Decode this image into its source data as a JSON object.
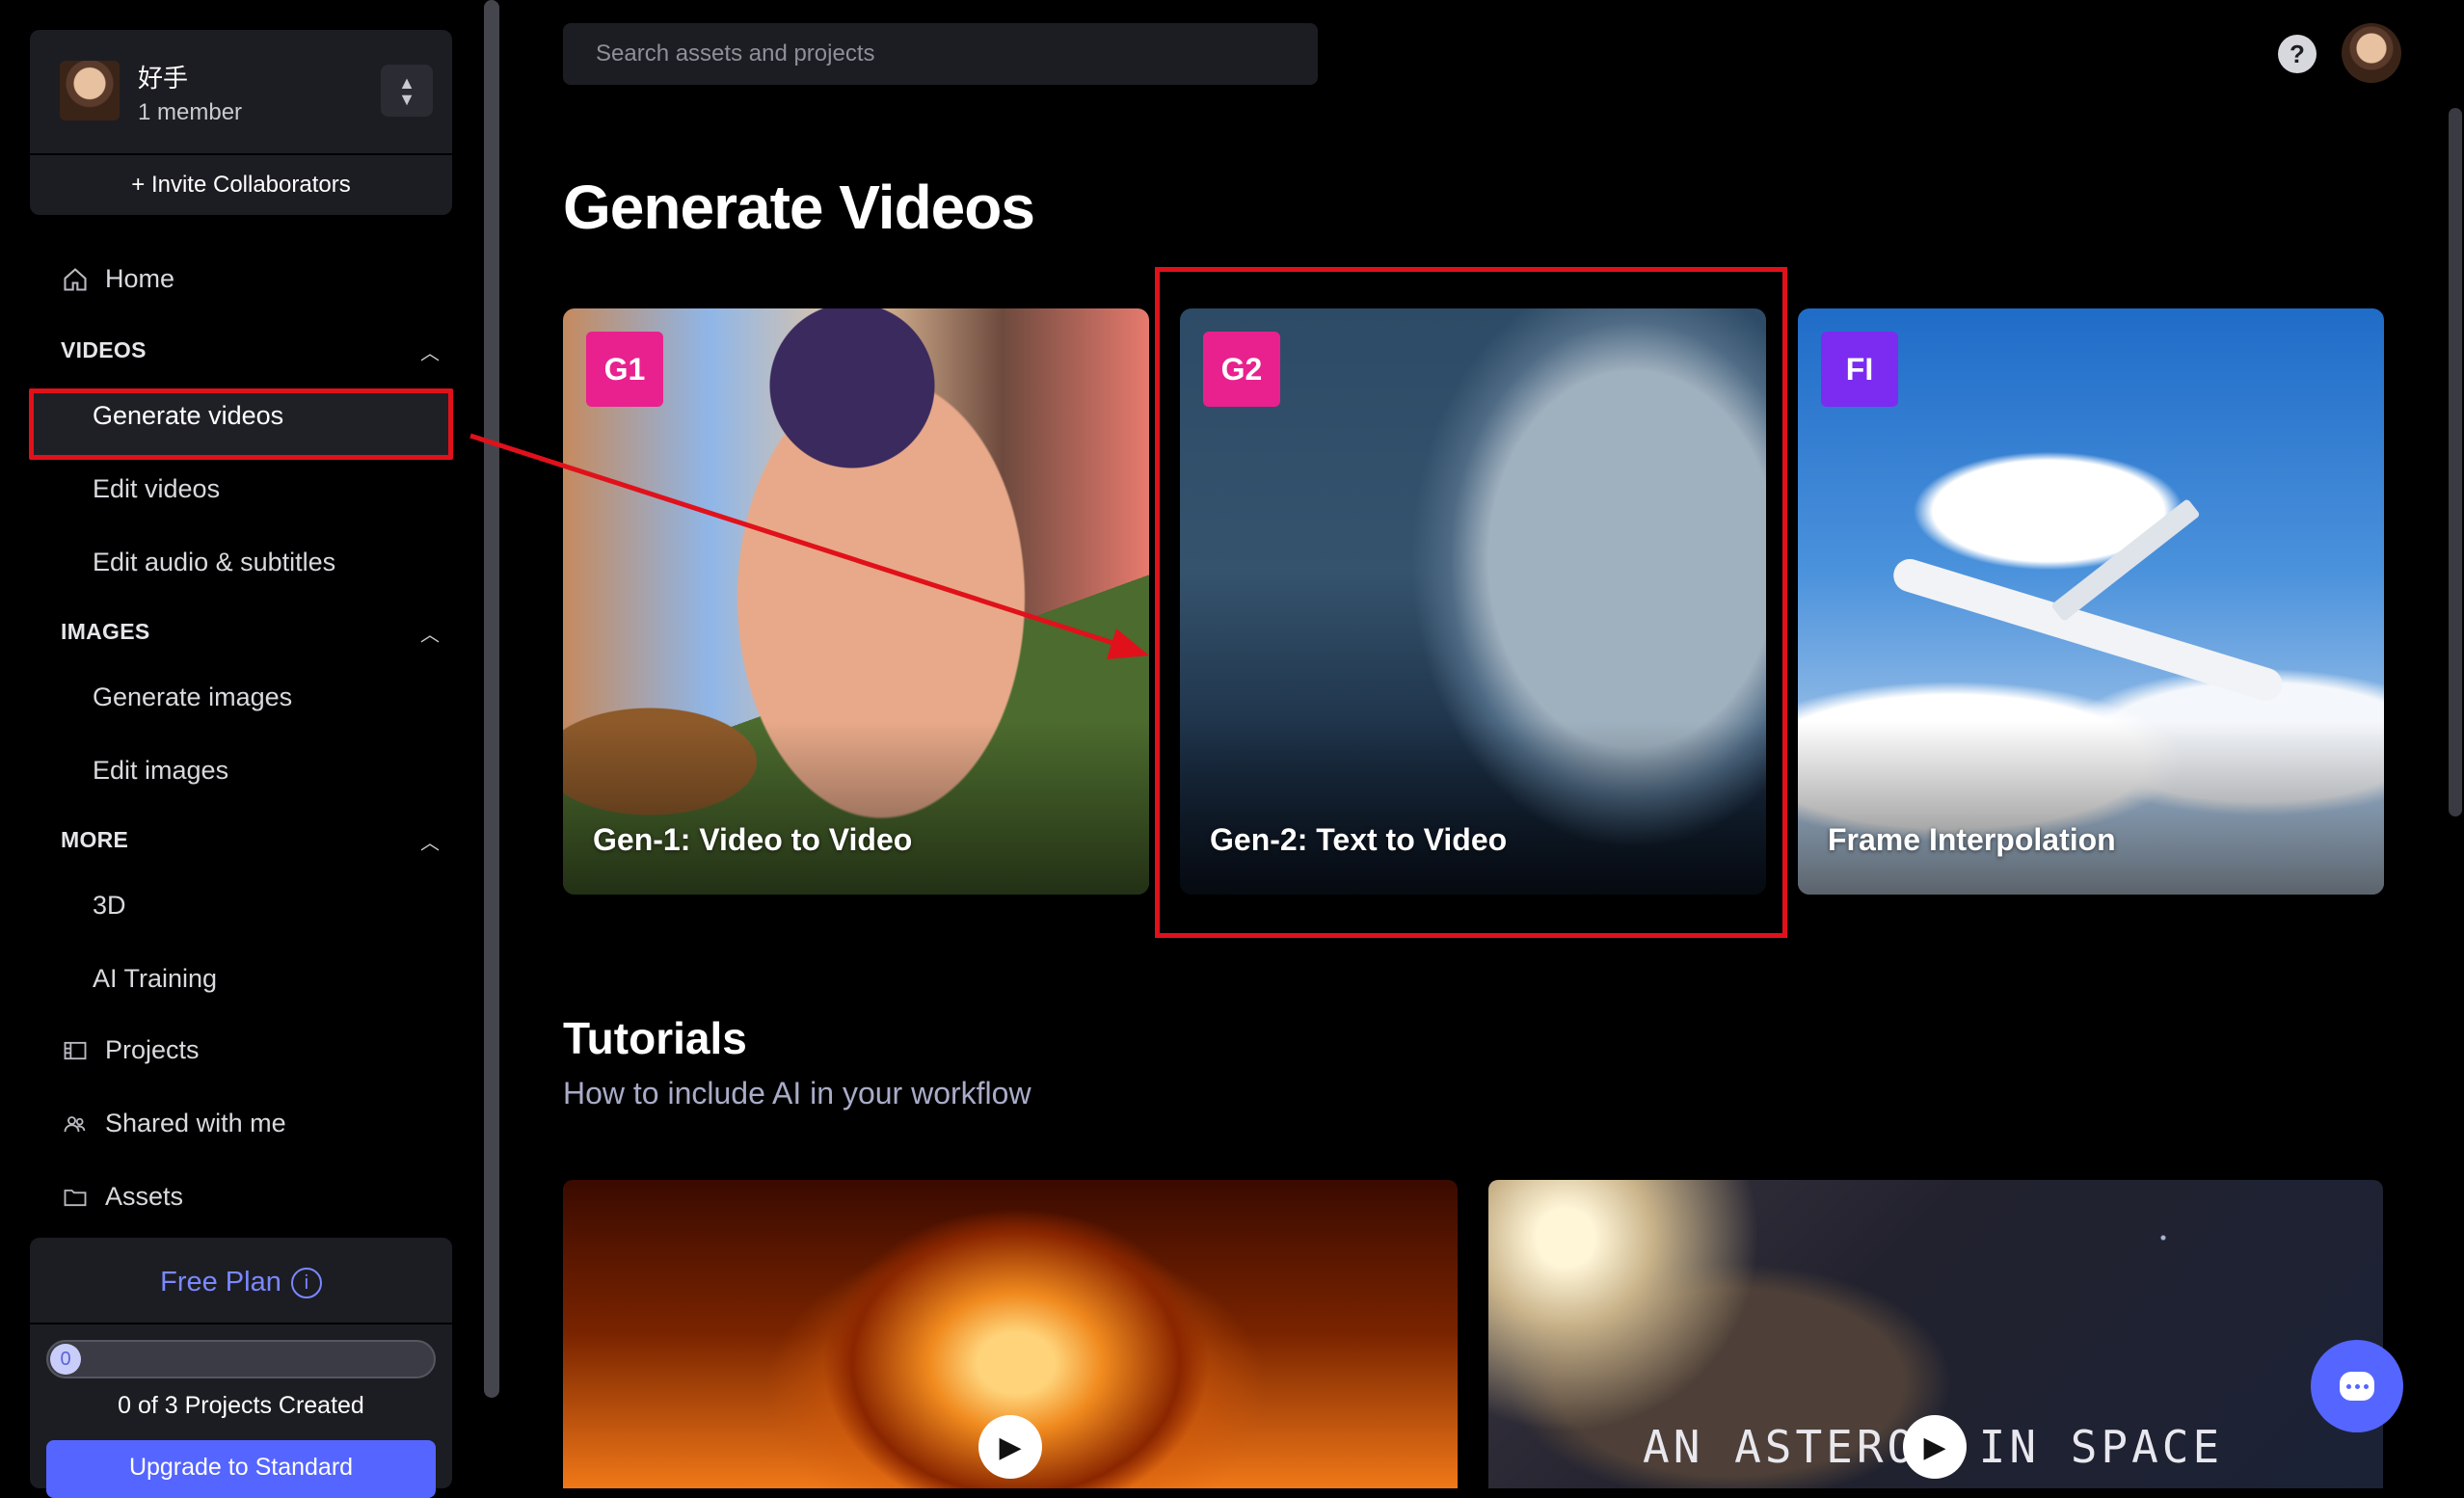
{
  "workspace": {
    "name": "好手",
    "members": "1 member",
    "invite_label": "+ Invite Collaborators"
  },
  "sidebar": {
    "home_label": "Home",
    "videos_section": "VIDEOS",
    "videos_items": [
      "Generate videos",
      "Edit videos",
      "Edit audio & subtitles"
    ],
    "images_section": "IMAGES",
    "images_items": [
      "Generate images",
      "Edit images"
    ],
    "more_section": "MORE",
    "more_items": [
      "3D",
      "AI Training"
    ],
    "projects_label": "Projects",
    "shared_label": "Shared with me",
    "assets_label": "Assets"
  },
  "plan": {
    "title": "Free Plan",
    "info_icon": "i",
    "progress_value": "0",
    "progress_fraction": 0,
    "count_text": "0 of 3 Projects Created",
    "upgrade_label": "Upgrade to Standard"
  },
  "search": {
    "placeholder": "Search assets and projects"
  },
  "header": {
    "help_icon": "?"
  },
  "main": {
    "title": "Generate Videos",
    "cards": [
      {
        "badge": "G1",
        "badge_color": "#e8218f",
        "title": "Gen-1: Video to Video"
      },
      {
        "badge": "G2",
        "badge_color": "#e8218f",
        "title": "Gen-2: Text to Video"
      },
      {
        "badge": "FI",
        "badge_color": "#7b2cf0",
        "title": "Frame Interpolation"
      }
    ],
    "tutorials_title": "Tutorials",
    "tutorials_subtitle": "How to include AI in your workflow",
    "tutorial_2_text": "AN ASTERO  IN SPACE"
  },
  "colors": {
    "accent": "#5565ff",
    "highlight": "#e0111b"
  }
}
